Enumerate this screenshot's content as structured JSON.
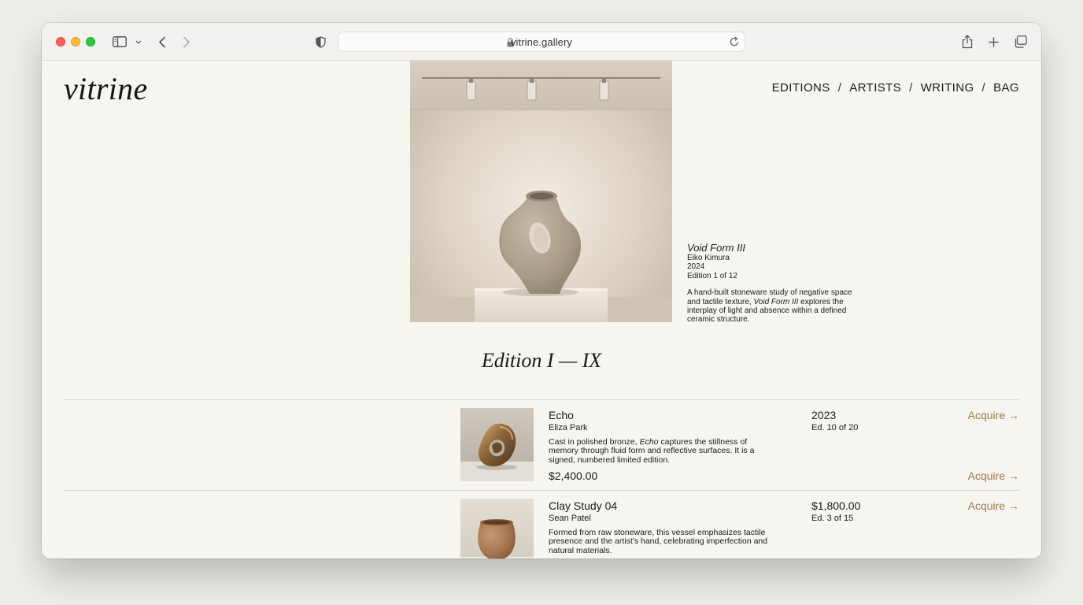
{
  "browser": {
    "url": "vitrine.gallery",
    "icons": [
      "sidebar-icon",
      "chevron-down-icon",
      "back-icon",
      "forward-icon",
      "shield-icon",
      "lock-icon",
      "reload-icon",
      "share-icon",
      "plus-icon",
      "tabs-icon"
    ]
  },
  "site": {
    "logo": "vitrine",
    "nav": [
      {
        "label": "EDITIONS"
      },
      {
        "label": "ARTISTS"
      },
      {
        "label": "WRITING"
      },
      {
        "label": "BAG"
      }
    ],
    "nav_separator": "/"
  },
  "featured": {
    "title": "Void Form III",
    "artist": "Eiko Kimura",
    "year": "2024",
    "edition": "Edition 1 of 12",
    "description_before": "A hand-built stoneware study of negative space and tactile texture, ",
    "description_em": "Void Form III",
    "description_after": " explores the interplay of light and absence within a defined ceramic structure."
  },
  "section": {
    "title": "Edition I — IX"
  },
  "items": [
    {
      "name": "Echo",
      "artist": "Eliza Park",
      "description_before": "Cast in polished bronze, ",
      "description_em": "Echo",
      "description_after": " captures the stillness of memory through fluid form and reflective surfaces. It is a signed, numbered limited edition.",
      "price": "$2,400.00",
      "col3_main": "2023",
      "col3_sub": "Ed. 10 of 20",
      "acquire_top": "Acquire →",
      "acquire_bottom": "Acquire →"
    },
    {
      "name": "Clay Study 04",
      "artist": "Sean Patel",
      "description_before": "Formed from raw stoneware, this vessel emphasizes tactile presence and the artist's hand, celebrating imperfection and natural materials.",
      "description_em": "",
      "description_after": "",
      "col3_main": "$1,800.00",
      "col3_sub": "Ed. 3 of 15",
      "acquire_top": "Acquire →"
    }
  ],
  "colors": {
    "page_bg": "#f6f5f0",
    "accent": "#9a7b4a",
    "text": "#1a1a1a"
  }
}
